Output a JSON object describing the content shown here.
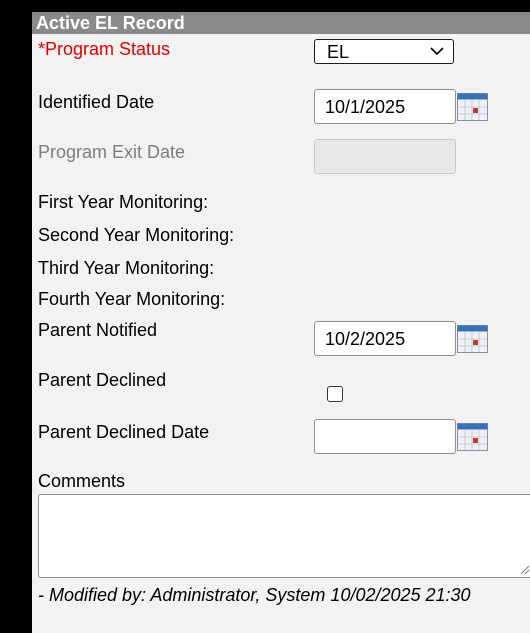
{
  "header": {
    "title": "Active EL Record"
  },
  "fields": {
    "program_status": {
      "label": "*Program Status",
      "value": "EL"
    },
    "identified_date": {
      "label": "Identified Date",
      "value": "10/1/2025"
    },
    "program_exit_date": {
      "label": "Program Exit Date",
      "value": ""
    },
    "first_year_monitoring": {
      "label": "First Year Monitoring:"
    },
    "second_year_monitoring": {
      "label": "Second Year Monitoring:"
    },
    "third_year_monitoring": {
      "label": "Third Year Monitoring:"
    },
    "fourth_year_monitoring": {
      "label": "Fourth Year Monitoring:"
    },
    "parent_notified": {
      "label": "Parent Notified",
      "value": "10/2/2025"
    },
    "parent_declined": {
      "label": "Parent Declined",
      "checked": false
    },
    "parent_declined_date": {
      "label": "Parent Declined Date",
      "value": ""
    },
    "comments": {
      "label": "Comments",
      "value": ""
    }
  },
  "footer": {
    "modified": "- Modified by: Administrator, System 10/02/2025 21:30"
  },
  "icons": {
    "calendar": "calendar-icon",
    "dropdown": "chevron-down-icon"
  },
  "colors": {
    "required_label": "#e00000",
    "header_bg": "#8a8a8a",
    "panel_bg": "#f2f2f2",
    "disabled_label": "#7d7d7d"
  }
}
